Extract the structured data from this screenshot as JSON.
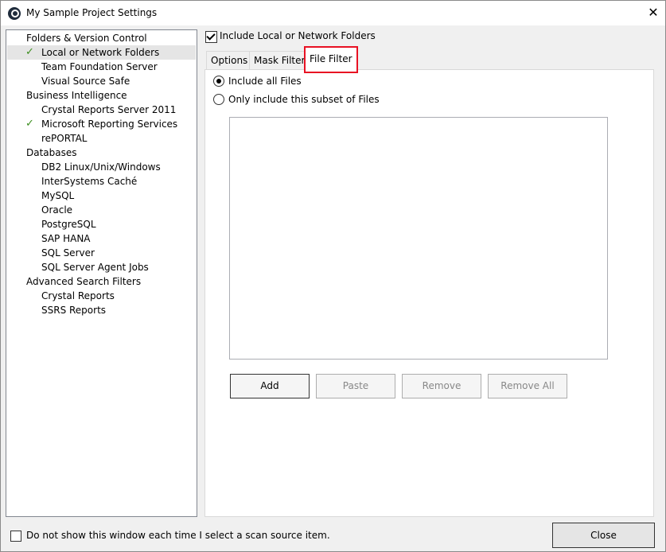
{
  "window": {
    "title": "My Sample Project Settings",
    "close_glyph": "✕"
  },
  "tree": {
    "check_glyph": "✓",
    "items": [
      {
        "label": "Folders & Version Control"
      },
      {
        "label": "Local or Network Folders",
        "checked": true,
        "selected": true
      },
      {
        "label": "Team Foundation Server"
      },
      {
        "label": "Visual Source Safe"
      },
      {
        "label": "Business Intelligence"
      },
      {
        "label": "Crystal Reports Server 2011"
      },
      {
        "label": "Microsoft Reporting Services",
        "checked": true
      },
      {
        "label": "rePORTAL"
      },
      {
        "label": "Databases"
      },
      {
        "label": "DB2 Linux/Unix/Windows"
      },
      {
        "label": "InterSystems Caché"
      },
      {
        "label": "MySQL"
      },
      {
        "label": "Oracle"
      },
      {
        "label": "PostgreSQL"
      },
      {
        "label": "SAP HANA"
      },
      {
        "label": "SQL Server"
      },
      {
        "label": "SQL Server Agent Jobs"
      },
      {
        "label": "Advanced Search Filters"
      },
      {
        "label": "Crystal Reports"
      },
      {
        "label": "SSRS Reports"
      }
    ]
  },
  "include_checkbox": {
    "label": "Include Local or Network Folders",
    "checked": true
  },
  "tabs": [
    {
      "label": "Options"
    },
    {
      "label": "Mask Filters"
    },
    {
      "label": "File Filter",
      "active": true
    }
  ],
  "file_filter": {
    "radio_all": {
      "label": "Include all Files",
      "selected": true
    },
    "radio_subset": {
      "label": "Only include this subset of Files",
      "selected": false
    },
    "buttons": {
      "add": "Add",
      "paste": "Paste",
      "remove": "Remove",
      "remove_all": "Remove All"
    }
  },
  "footer": {
    "dont_show_label": "Do not show this window each time I select a scan source item.",
    "close_label": "Close"
  },
  "colors": {
    "tab_highlight": "#e81123",
    "check_green": "#3c8e1e"
  },
  "icons": {
    "app": "app-logo-icon",
    "close": "close-icon",
    "check": "check-icon"
  }
}
